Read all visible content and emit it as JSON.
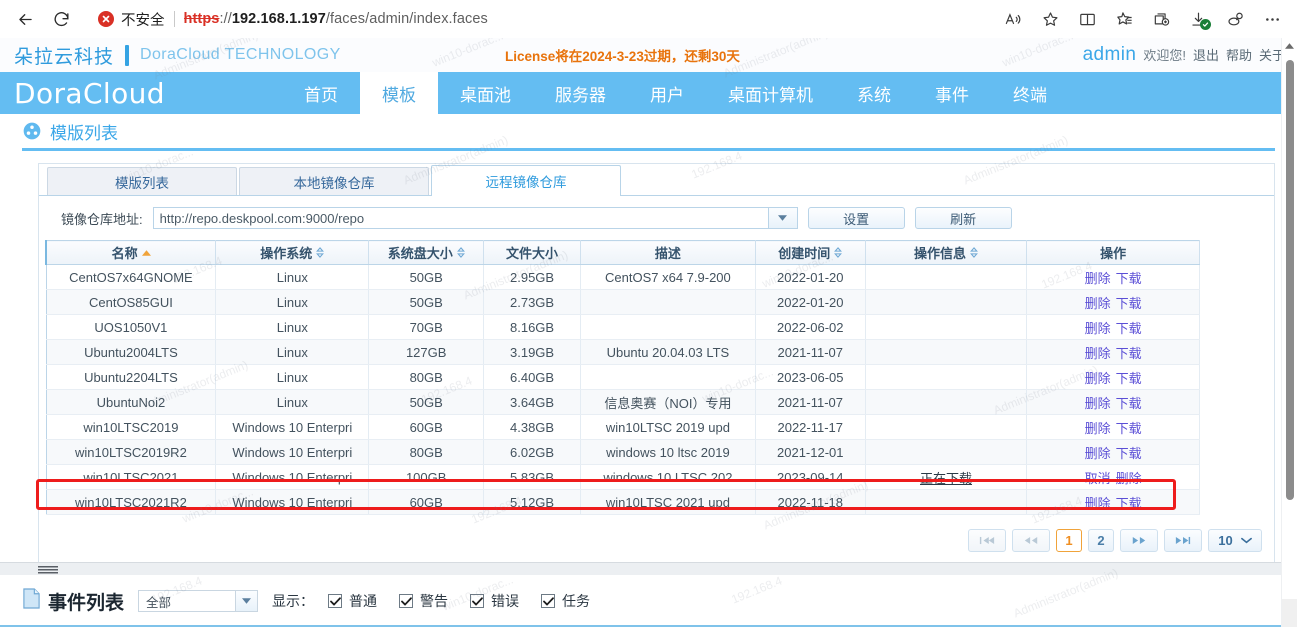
{
  "browser": {
    "back_label": "back-arrow",
    "reload_label": "reload",
    "security_text": "不安全",
    "url_scheme": "https",
    "url_sep": "://",
    "url_host": "192.168.1.197",
    "url_path": "/faces/admin/index.faces",
    "tools": [
      "read-aloud",
      "favorite",
      "split-screen",
      "collections",
      "add-to-collection",
      "downloads",
      "copilot",
      "more"
    ]
  },
  "topbar": {
    "brand_cn": "朵拉云科技",
    "brand_en": "DoraCloud TECHNOLOGY",
    "license_notice": "License将在2024-3-23过期，还剩30天",
    "user": "admin",
    "welcome": "欢迎您!",
    "logout": "退出",
    "help": "帮助",
    "about": "关于"
  },
  "nav": {
    "logo": "DoraCloud",
    "items": [
      {
        "label": "首页",
        "active": false
      },
      {
        "label": "模板",
        "active": true
      },
      {
        "label": "桌面池",
        "active": false
      },
      {
        "label": "服务器",
        "active": false
      },
      {
        "label": "用户",
        "active": false
      },
      {
        "label": "桌面计算机",
        "active": false
      },
      {
        "label": "系统",
        "active": false
      },
      {
        "label": "事件",
        "active": false
      },
      {
        "label": "终端",
        "active": false
      }
    ]
  },
  "page_header": {
    "title": "模版列表"
  },
  "tabs": [
    {
      "label": "模版列表",
      "active": false
    },
    {
      "label": "本地镜像仓库",
      "active": false
    },
    {
      "label": "远程镜像仓库",
      "active": true
    }
  ],
  "repo": {
    "label": "镜像仓库地址:",
    "value": "http://repo.deskpool.com:9000/repo",
    "settings_button": "设置",
    "refresh_button": "刷新"
  },
  "table": {
    "columns": [
      {
        "label": "名称",
        "sort": "asc"
      },
      {
        "label": "操作系统",
        "sort": "both"
      },
      {
        "label": "系统盘大小",
        "sort": "both"
      },
      {
        "label": "文件大小",
        "sort": "none"
      },
      {
        "label": "描述",
        "sort": "none"
      },
      {
        "label": "创建时间",
        "sort": "both"
      },
      {
        "label": "操作信息",
        "sort": "both"
      },
      {
        "label": "操作",
        "sort": "none"
      }
    ],
    "rows": [
      {
        "name": "CentOS7x64GNOME",
        "os": "Linux",
        "disk": "50GB",
        "size": "2.95GB",
        "desc": "CentOS7 x64 7.9-200",
        "created": "2022-01-20",
        "opinfo": "",
        "ops": [
          "删除",
          "下载"
        ]
      },
      {
        "name": "CentOS85GUI",
        "os": "Linux",
        "disk": "50GB",
        "size": "2.73GB",
        "desc": "",
        "created": "2022-01-20",
        "opinfo": "",
        "ops": [
          "删除",
          "下载"
        ]
      },
      {
        "name": "UOS1050V1",
        "os": "Linux",
        "disk": "70GB",
        "size": "8.16GB",
        "desc": "",
        "created": "2022-06-02",
        "opinfo": "",
        "ops": [
          "删除",
          "下载"
        ]
      },
      {
        "name": "Ubuntu2004LTS",
        "os": "Linux",
        "disk": "127GB",
        "size": "3.19GB",
        "desc": "Ubuntu 20.04.03 LTS",
        "created": "2021-11-07",
        "opinfo": "",
        "ops": [
          "删除",
          "下载"
        ]
      },
      {
        "name": "Ubuntu2204LTS",
        "os": "Linux",
        "disk": "80GB",
        "size": "6.40GB",
        "desc": "",
        "created": "2023-06-05",
        "opinfo": "",
        "ops": [
          "删除",
          "下载"
        ]
      },
      {
        "name": "UbuntuNoi2",
        "os": "Linux",
        "disk": "50GB",
        "size": "3.64GB",
        "desc": "信息奥赛（NOI）专用",
        "created": "2021-11-07",
        "opinfo": "",
        "ops": [
          "删除",
          "下载"
        ]
      },
      {
        "name": "win10LTSC2019",
        "os": "Windows 10 Enterpri",
        "disk": "60GB",
        "size": "4.38GB",
        "desc": "win10LTSC 2019 upd",
        "created": "2022-11-17",
        "opinfo": "",
        "ops": [
          "删除",
          "下载"
        ]
      },
      {
        "name": "win10LTSC2019R2",
        "os": "Windows 10 Enterpri",
        "disk": "80GB",
        "size": "6.02GB",
        "desc": "windows 10 ltsc 2019",
        "created": "2021-12-01",
        "opinfo": "",
        "ops": [
          "删除",
          "下载"
        ]
      },
      {
        "name": "win10LTSC2021",
        "os": "Windows 10 Enterpri",
        "disk": "100GB",
        "size": "5.83GB",
        "desc": "windows 10 LTSC 202",
        "created": "2023-09-14",
        "opinfo": "正在下载",
        "ops": [
          "取消",
          "删除"
        ],
        "highlighted": true
      },
      {
        "name": "win10LTSC2021R2",
        "os": "Windows 10 Enterpri",
        "disk": "60GB",
        "size": "5.12GB",
        "desc": "win10LTSC 2021 upd",
        "created": "2022-11-18",
        "opinfo": "",
        "ops": [
          "删除",
          "下载"
        ]
      }
    ]
  },
  "pagination": {
    "first": "⏮",
    "prev": "◀◀",
    "pages": [
      {
        "label": "1",
        "active": true
      },
      {
        "label": "2",
        "active": false
      }
    ],
    "next": "▶▶",
    "last": "▶⏴",
    "page_size": "10"
  },
  "events": {
    "title": "事件列表",
    "filter_value": "全部",
    "show_label": "显示：",
    "checkboxes": [
      {
        "label": "普通",
        "checked": true
      },
      {
        "label": "警告",
        "checked": true
      },
      {
        "label": "错误",
        "checked": true
      },
      {
        "label": "任务",
        "checked": true
      }
    ]
  },
  "colors": {
    "nav_blue": "#64bdf2",
    "brand_blue": "#2f9bdd",
    "license_orange": "#e8730c",
    "link_purple": "#5b4fd6",
    "highlight_red": "#ee1c1c"
  }
}
